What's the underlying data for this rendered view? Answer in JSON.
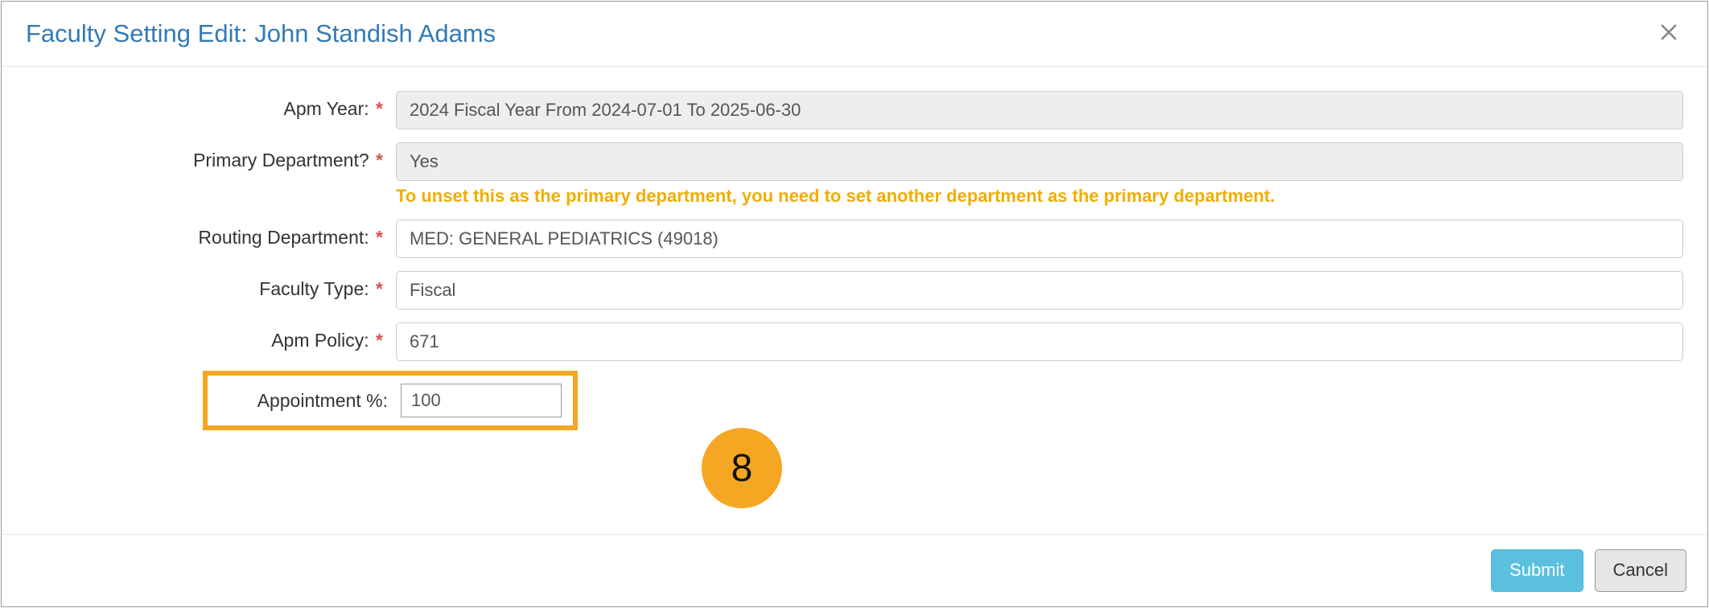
{
  "header": {
    "title": "Faculty Setting Edit: John Standish Adams"
  },
  "form": {
    "apm_year": {
      "label": "Apm Year:",
      "required": true,
      "value": "2024 Fiscal Year From 2024-07-01 To 2025-06-30"
    },
    "primary_dept": {
      "label": "Primary Department?",
      "required": true,
      "value": "Yes",
      "help": "To unset this as the primary department, you need to set another department as the primary department."
    },
    "routing_dept": {
      "label": "Routing Department:",
      "required": true,
      "value": "MED: GENERAL PEDIATRICS (49018)"
    },
    "faculty_type": {
      "label": "Faculty Type:",
      "required": true,
      "value": "Fiscal"
    },
    "apm_policy": {
      "label": "Apm Policy:",
      "required": true,
      "value": "671"
    },
    "appointment_pct": {
      "label": "Appointment %:",
      "value": "100"
    }
  },
  "callout": {
    "number": "8"
  },
  "footer": {
    "submit": "Submit",
    "cancel": "Cancel"
  }
}
